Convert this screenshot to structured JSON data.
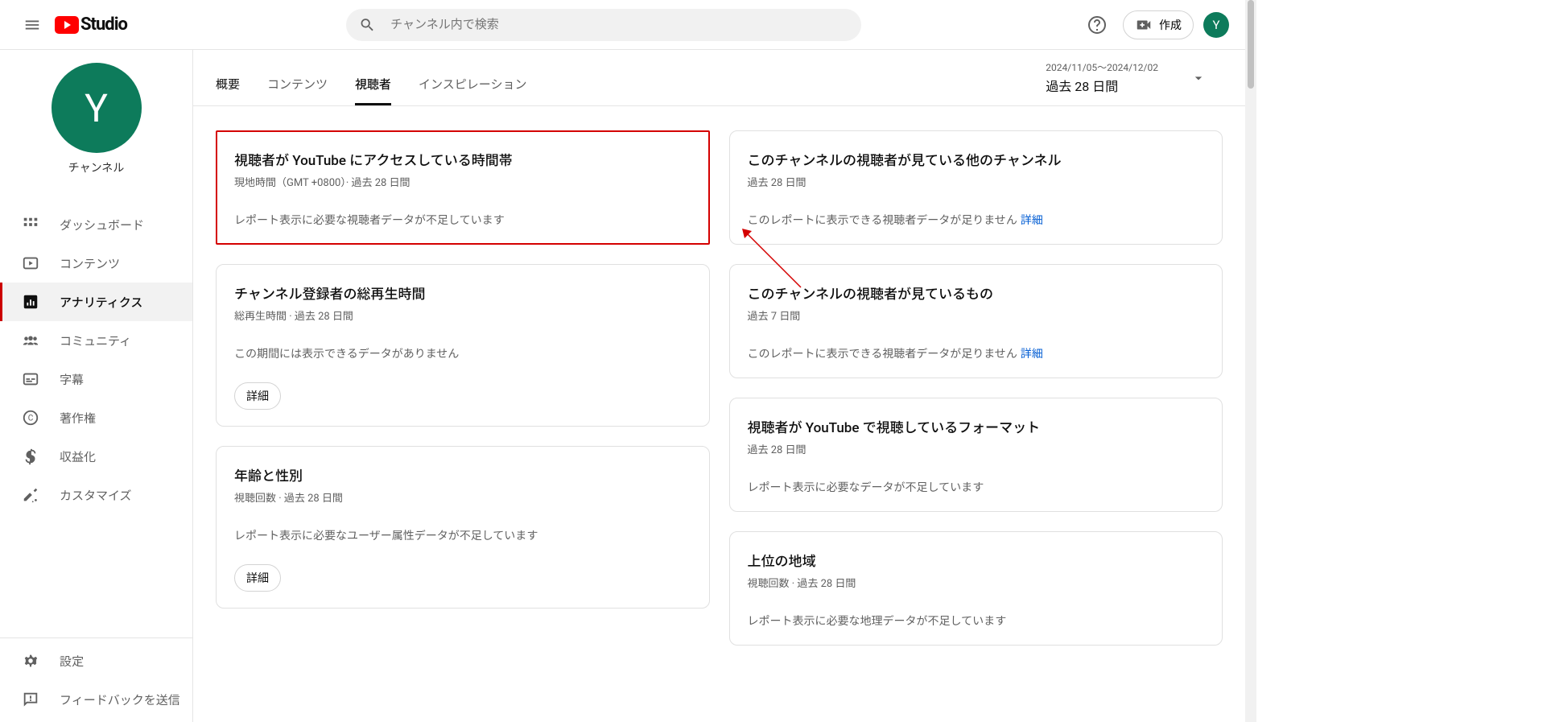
{
  "header": {
    "logo_text": "Studio",
    "search_placeholder": "チャンネル内で検索",
    "create_label": "作成",
    "avatar_letter": "Y"
  },
  "sidebar": {
    "channel_avatar_letter": "Y",
    "channel_label": "チャンネル",
    "channel_name": "　　　　",
    "nav": [
      {
        "icon": "dashboard",
        "label": "ダッシュボード"
      },
      {
        "icon": "content",
        "label": "コンテンツ"
      },
      {
        "icon": "analytics",
        "label": "アナリティクス",
        "active": true
      },
      {
        "icon": "community",
        "label": "コミュニティ"
      },
      {
        "icon": "subtitles",
        "label": "字幕"
      },
      {
        "icon": "copyright",
        "label": "著作権"
      },
      {
        "icon": "monetize",
        "label": "収益化"
      },
      {
        "icon": "customize",
        "label": "カスタマイズ"
      }
    ],
    "bottom": [
      {
        "icon": "settings",
        "label": "設定"
      },
      {
        "icon": "feedback",
        "label": "フィードバックを送信"
      }
    ]
  },
  "tabs": {
    "items": [
      "概要",
      "コンテンツ",
      "視聴者",
      "インスピレーション"
    ],
    "active_index": 2
  },
  "date_picker": {
    "range": "2024/11/05～2024/12/02",
    "label": "過去 28 日間"
  },
  "cards": {
    "left": [
      {
        "title": "視聴者が YouTube にアクセスしている時間帯",
        "sub": "現地時間（GMT +0800）· 過去 28 日間",
        "body": "レポート表示に必要な視聴者データが不足しています",
        "highlighted": true
      },
      {
        "title": "チャンネル登録者の総再生時間",
        "sub": "総再生時間 · 過去 28 日間",
        "body": "この期間には表示できるデータがありません",
        "button": "詳細"
      },
      {
        "title": "年齢と性別",
        "sub": "視聴回数 · 過去 28 日間",
        "body": "レポート表示に必要なユーザー属性データが不足しています",
        "button": "詳細"
      }
    ],
    "right": [
      {
        "title": "このチャンネルの視聴者が見ている他のチャンネル",
        "sub": "過去 28 日間",
        "body": "このレポートに表示できる視聴者データが足りません",
        "link": "詳細"
      },
      {
        "title": "このチャンネルの視聴者が見ているもの",
        "sub": "過去 7 日間",
        "body": "このレポートに表示できる視聴者データが足りません",
        "link": "詳細"
      },
      {
        "title": "視聴者が YouTube で視聴しているフォーマット",
        "sub": "過去 28 日間",
        "body": "レポート表示に必要なデータが不足しています"
      },
      {
        "title": "上位の地域",
        "sub": "視聴回数 · 過去 28 日間",
        "body": "レポート表示に必要な地理データが不足しています"
      }
    ]
  }
}
